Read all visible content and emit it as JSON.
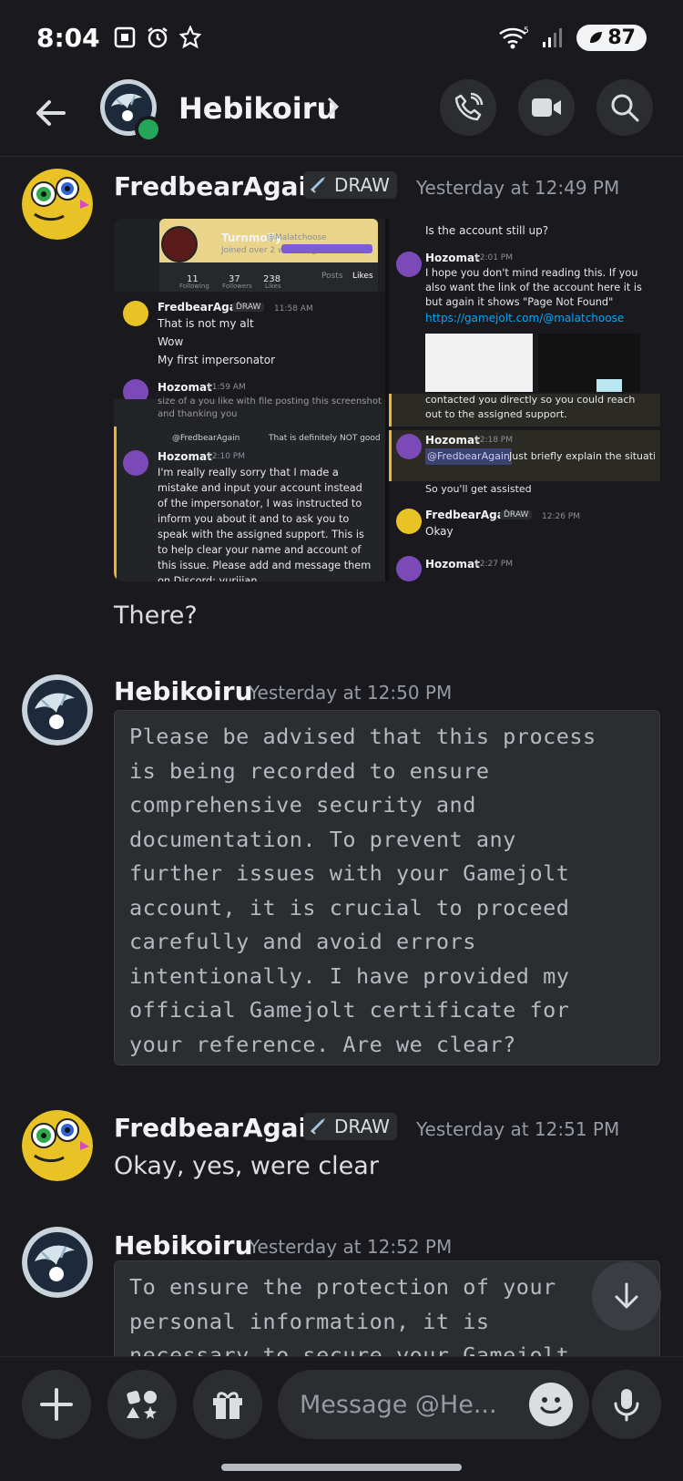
{
  "status_bar": {
    "time": "8:04",
    "battery": "87"
  },
  "header": {
    "title": "Hebikoiru"
  },
  "messages": [
    {
      "author": "FredbearAgain",
      "badge": "DRAW",
      "timestamp": "Yesterday at 12:49 PM",
      "text": "There?"
    },
    {
      "author": "Hebikoiru",
      "timestamp": "Yesterday at 12:50 PM",
      "code": "Please be advised that this process\nis being recorded to ensure\ncomprehensive security and\ndocumentation. To prevent any\nfurther issues with your Gamejolt\naccount, it is crucial to proceed\ncarefully and avoid errors\nintentionally. I have provided my\nofficial Gamejolt certificate for\nyour reference. Are we clear?"
    },
    {
      "author": "FredbearAgain",
      "badge": "DRAW",
      "timestamp": "Yesterday at 12:51 PM",
      "text": "Okay, yes, were clear"
    },
    {
      "author": "Hebikoiru",
      "timestamp": "Yesterday at 12:52 PM",
      "code": "To ensure the protection of your\npersonal information, it is\nnecessary to secure your Gamejolt"
    }
  ],
  "attachment": {
    "profile_name": "Turnmolly",
    "profile_handle": "@Malatchoose",
    "profile_joined": "Joined over 2 weeks ago",
    "stats": [
      {
        "value": "11",
        "label": "Following"
      },
      {
        "value": "37",
        "label": "Followers"
      },
      {
        "value": "238",
        "label": "Likes"
      }
    ],
    "tabs": [
      "Posts",
      "Likes"
    ],
    "left_author": "FredbearAgain",
    "left_badge": "DRAW",
    "left_time": "11:58 AM",
    "left_lines": [
      "That is not my alt",
      "Wow",
      "My first impersonator"
    ],
    "left_next_author": "Hozomat",
    "left_next_time": "11:59 AM",
    "left_cut_line1": "size of a you like with file posting this screenshot",
    "left_cut_line2": "and thanking you",
    "reply_author": "@FredbearAgain",
    "reply_text": "That is definitely NOT good",
    "hozo_author": "Hozomat",
    "hozo_time": "12:10 PM",
    "hozo_text": "I'm really really sorry that I made a mistake and input your account instead of the impersonator, I was instructed to inform you about it and to ask you to speak with the assigned support. This is to help clear your name and account of this issue. Please add and message them on Discord: yuriiian",
    "right_top": "Is the account still up?",
    "right_author": "Hozomat",
    "right_time": "12:01 PM",
    "right_text": "I hope you don't mind reading this. If you also want the link of the account here it is but again it shows \"Page Not Found\"",
    "right_link": "https://gamejolt.com/@malatchoose",
    "right_mid1": "contacted you directly so you could reach",
    "right_mid2": "out to the assigned support.",
    "right_author2": "Hozomat",
    "right_time2": "12:18 PM",
    "right_mention": "@FredbearAgain",
    "right_text2": "Just briefly explain the situation to and have a talk about this issues",
    "right_text3": "So you'll get assisted",
    "right_author3": "FredbearAgain",
    "right_badge3": "DRAW",
    "right_time3": "12:26 PM",
    "right_text4": "Okay",
    "right_author4": "Hozomat",
    "right_time4": "12:27 PM"
  },
  "composer": {
    "placeholder": "Message @He..."
  },
  "colors": {
    "background": "#1a1a1e",
    "surface": "#2b2d31",
    "online": "#23a55a",
    "link": "#00a8fc",
    "mention_bg": "#3c4270"
  }
}
